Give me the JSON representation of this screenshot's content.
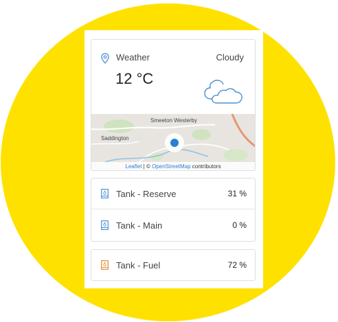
{
  "weather": {
    "label": "Weather",
    "condition": "Cloudy",
    "temperature": "12 °C",
    "icons": {
      "location": "location-pin-icon",
      "condition": "cloud-icon"
    }
  },
  "map": {
    "place_labels": [
      "Smeeton Westerby",
      "Saddington"
    ],
    "attribution": {
      "leaflet": "Leaflet",
      "separator": " | © ",
      "osm": "OpenStreetMap",
      "suffix": " contributors"
    }
  },
  "tanks": [
    {
      "name": "Tank - Reserve",
      "value": "31 %",
      "icon": "tank-icon",
      "color": "#4a8fd0"
    },
    {
      "name": "Tank - Main",
      "value": "0 %",
      "icon": "tank-icon",
      "color": "#4a8fd0"
    },
    {
      "name": "Tank - Fuel",
      "value": "72 %",
      "icon": "tank-icon",
      "color": "#e08a3a"
    }
  ],
  "colors": {
    "background": "#ffe100",
    "accent": "#2a7fd1",
    "marker": "#2a7fd1"
  }
}
